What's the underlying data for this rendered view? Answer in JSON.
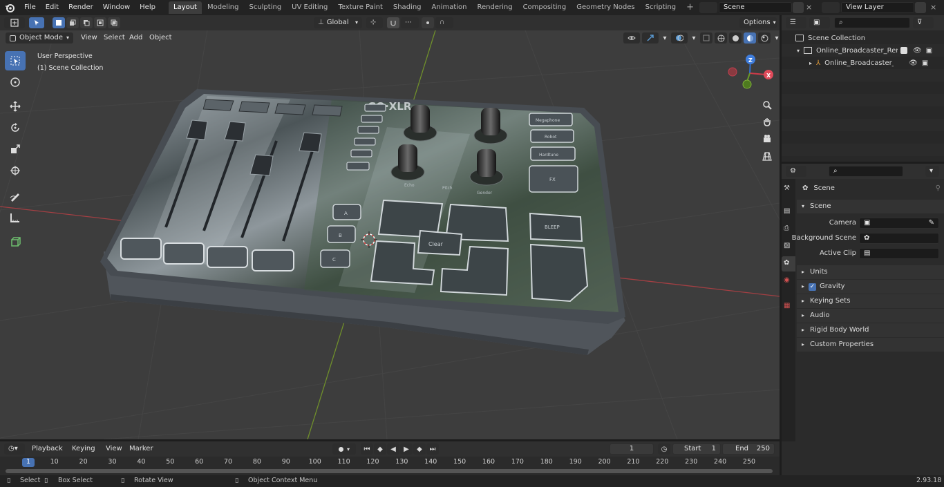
{
  "topbar": {
    "menus": [
      "File",
      "Edit",
      "Render",
      "Window",
      "Help"
    ],
    "workspaces": [
      "Layout",
      "Modeling",
      "Sculpting",
      "UV Editing",
      "Texture Paint",
      "Shading",
      "Animation",
      "Rendering",
      "Compositing",
      "Geometry Nodes",
      "Scripting"
    ],
    "active_workspace": "Layout",
    "scene": "Scene",
    "view_layer": "View Layer"
  },
  "viewport_header": {
    "mode": "Object Mode",
    "menus": [
      "View",
      "Select",
      "Add",
      "Object"
    ],
    "orientation": "Global",
    "options": "Options"
  },
  "viewport": {
    "perspective_label": "User Perspective",
    "collection_label": "(1) Scene Collection",
    "gizmo": {
      "z": "Z",
      "x": "X"
    }
  },
  "device_labels": {
    "brand": "GO·XLR",
    "top_buttons": [
      "Megaphone",
      "Robot",
      "Hardtune",
      "FX"
    ],
    "knob_labels": [
      "Echo",
      "Pitch",
      "Gender"
    ],
    "clear": "Clear",
    "bleep": "BLEEP",
    "left_keys": [
      "A",
      "B",
      "C"
    ]
  },
  "outliner": {
    "root": "Scene Collection",
    "items": [
      "Online_Broadcaster_Remote_",
      "Online_Broadcaster_Rem"
    ]
  },
  "properties": {
    "breadcrumb": "Scene",
    "panel": "Scene",
    "camera_label": "Camera",
    "background_label": "Background Scene",
    "clip_label": "Active Clip",
    "sections": [
      "Units",
      "Gravity",
      "Keying Sets",
      "Audio",
      "Rigid Body World",
      "Custom Properties"
    ]
  },
  "timeline": {
    "menus": [
      "Playback",
      "Keying",
      "View",
      "Marker"
    ],
    "current_frame": "1",
    "start_label": "Start",
    "start": "1",
    "end_label": "End",
    "end": "250",
    "ticks": [
      "1",
      "10",
      "20",
      "30",
      "40",
      "50",
      "60",
      "70",
      "80",
      "90",
      "100",
      "110",
      "120",
      "130",
      "140",
      "150",
      "160",
      "170",
      "180",
      "190",
      "200",
      "210",
      "220",
      "230",
      "240",
      "250"
    ]
  },
  "statusbar": {
    "select": "Select",
    "box_select": "Box Select",
    "rotate": "Rotate View",
    "context": "Object Context Menu",
    "version": "2.93.18"
  },
  "colors": {
    "accent": "#4772b3",
    "axis_x": "#a33f43",
    "axis_y": "#6f8f2b"
  }
}
